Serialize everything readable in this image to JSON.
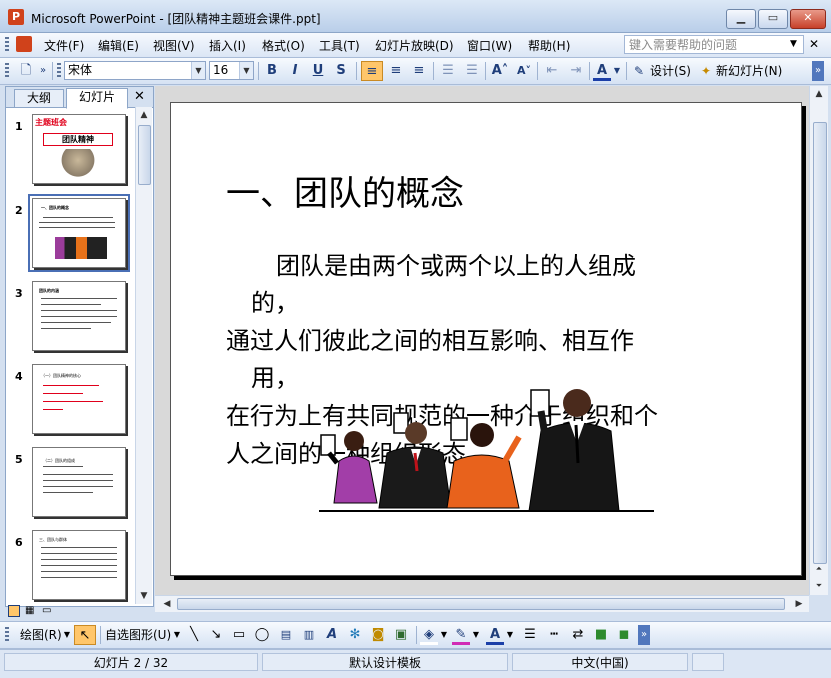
{
  "window": {
    "title": "Microsoft PowerPoint - [团队精神主题班会课件.ppt]",
    "app_icon": "powerpoint-icon"
  },
  "menubar": {
    "items": [
      "文件(F)",
      "编辑(E)",
      "视图(V)",
      "插入(I)",
      "格式(O)",
      "工具(T)",
      "幻灯片放映(D)",
      "窗口(W)",
      "帮助(H)"
    ],
    "help_placeholder": "键入需要帮助的问题"
  },
  "formatting": {
    "font": "宋体",
    "size": "16",
    "design_label": "设计(S)",
    "new_slide_label": "新幻灯片(N)"
  },
  "panel": {
    "tabs": [
      "大纲",
      "幻灯片"
    ],
    "selected_tab": "幻灯片"
  },
  "thumbnails": [
    {
      "number": "1",
      "title": "主题班会",
      "subtitle": "团队精神"
    },
    {
      "number": "2",
      "title": "一、团队的概念"
    },
    {
      "number": "3",
      "title": "团队的内涵"
    },
    {
      "number": "4",
      "title": "（一）团队精神的核心"
    },
    {
      "number": "5",
      "title": "（二）团队的组成"
    },
    {
      "number": "6",
      "title": "三、团队与群体"
    }
  ],
  "slide": {
    "title": "一、团队的概念",
    "body": [
      "团队是由两个或两个以上的人组成",
      "的，",
      "通过人们彼此之间的相互影响、相互作",
      "用，",
      "在行为上有共同规范的一种介于组织和个",
      "人之间的一种组织形态。"
    ]
  },
  "drawbar": {
    "draw_label": "绘图(R)",
    "autoshape_label": "自选图形(U)"
  },
  "status": {
    "slide_counter": "幻灯片 2 / 32",
    "template": "默认设计模板",
    "language": "中文(中国)"
  },
  "colors": {
    "accent": "#4A6FB5",
    "title_red": "#E0001B"
  }
}
